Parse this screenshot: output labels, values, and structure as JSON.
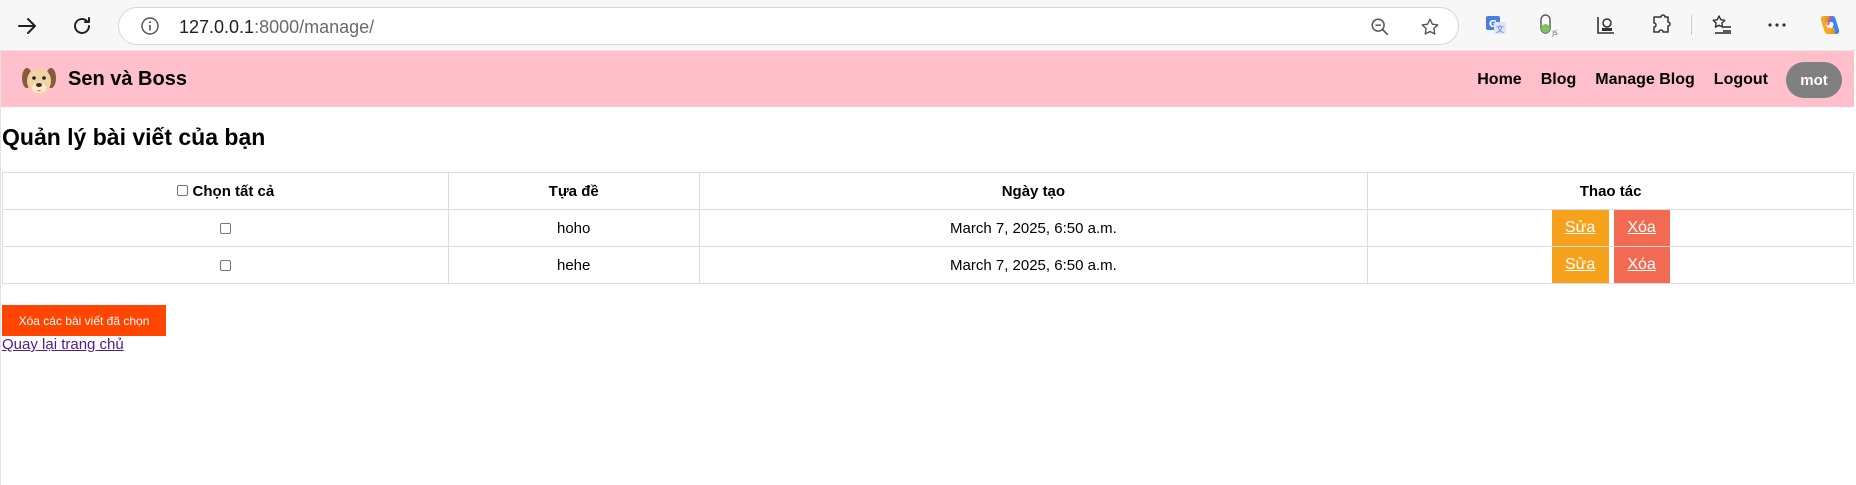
{
  "browser": {
    "url_host": "127.0.0.1",
    "url_path": ":8000/manage/",
    "icons": {
      "forward": "forward-arrow-icon",
      "reload": "reload-icon",
      "site_info": "info-icon",
      "zoom": "zoom-out-icon",
      "favorite": "star-icon",
      "translate": "translate-extension-icon",
      "js_extension": "js-extension-icon",
      "lab_extension": "lab-extension-icon",
      "extensions": "puzzle-icon",
      "favorites": "favorites-list-icon",
      "more": "more-icon",
      "copilot": "copilot-icon"
    }
  },
  "navbar": {
    "brand": "Sen và Boss",
    "background": "#ffc0cb",
    "links": [
      {
        "label": "Home"
      },
      {
        "label": "Blog"
      },
      {
        "label": "Manage Blog"
      },
      {
        "label": "Logout"
      }
    ],
    "user": "mot"
  },
  "page": {
    "heading": "Quản lý bài viết của bạn",
    "table": {
      "headers": {
        "select_all": "Chọn tất cả",
        "title": "Tựa đề",
        "created": "Ngày tạo",
        "actions": "Thao tác"
      },
      "rows": [
        {
          "title": "hoho",
          "created": "March 7, 2025, 6:50 a.m.",
          "checked": false
        },
        {
          "title": "hehe",
          "created": "March 7, 2025, 6:50 a.m.",
          "checked": false
        }
      ],
      "edit_label": "Sửa",
      "delete_label": "Xóa"
    },
    "bulk_delete_label": "Xóa các bài viết đã chọn",
    "back_link": "Quay lại trang chủ"
  },
  "colors": {
    "edit_button": "#f7a21c",
    "delete_button": "#f26a52",
    "bulk_delete": "#ff4500",
    "user_pill": "#808080"
  }
}
